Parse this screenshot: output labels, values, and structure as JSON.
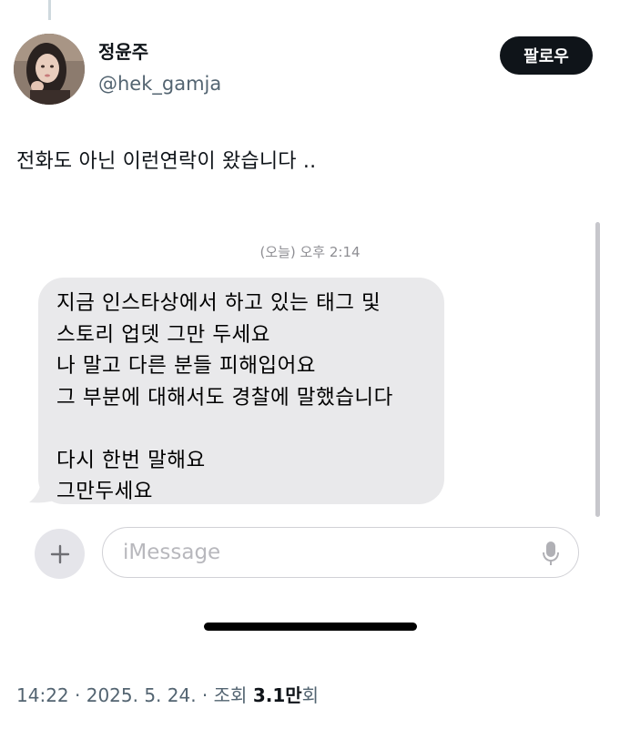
{
  "author": {
    "display_name": "정윤주",
    "handle": "@hek_gamja",
    "follow_label": "팔로우"
  },
  "tweet": {
    "text": "전화도 아닌 이런연락이 왔습니다 .."
  },
  "screenshot": {
    "timestamp": "(오늘) 오후 2:14",
    "message_lines": [
      "지금 인스타상에서 하고 있는 태그 및",
      "스토리 업뎃 그만 두세요",
      "나 말고 다른 분들 피해입어요",
      "그 부분에 대해서도 경찰에 말했습니다",
      "",
      "다시 한번 말해요",
      "그만두세요"
    ],
    "input_placeholder": "iMessage",
    "plus_icon": "plus-icon",
    "mic_icon": "microphone-icon"
  },
  "meta": {
    "time": "14:22",
    "separator1": " · ",
    "date": "2025. 5. 24.",
    "separator2": " · ",
    "views_label": "조회 ",
    "views_count": "3.1",
    "views_unit_bold": "만",
    "views_suffix": "회"
  },
  "colors": {
    "bubble": "#e9e9eb",
    "follow_button": "#0f1419",
    "secondary_text": "#536471"
  }
}
